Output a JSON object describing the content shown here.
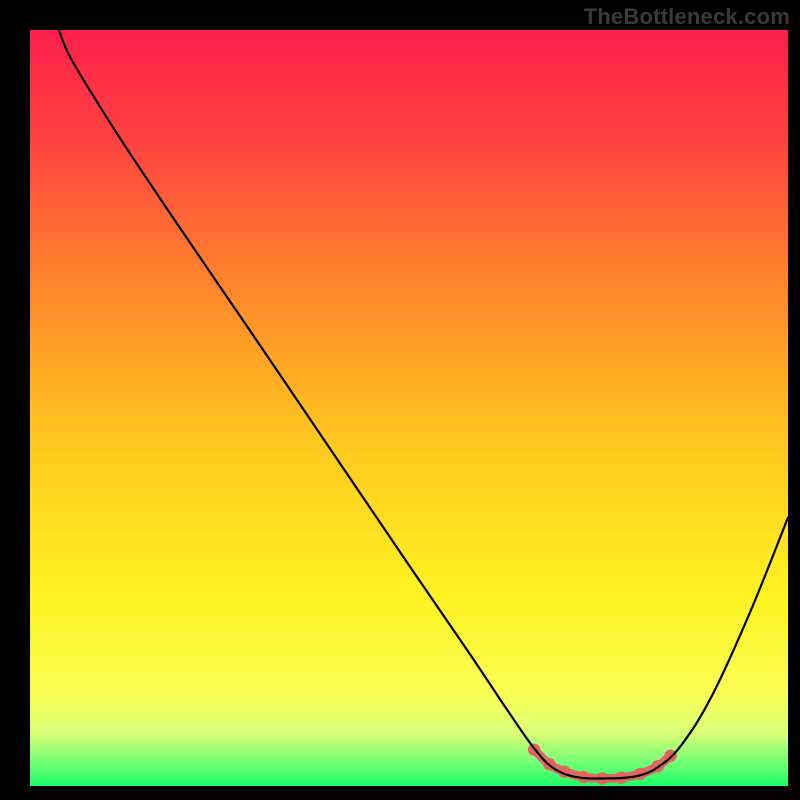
{
  "watermark": "TheBottleneck.com",
  "chart_data": {
    "type": "line",
    "title": "",
    "xlabel": "",
    "ylabel": "",
    "xlim": [
      0,
      100
    ],
    "ylim": [
      0,
      100
    ],
    "grid": false,
    "legend": false,
    "gradient_stops": [
      {
        "offset": 0.0,
        "color": "#ff1f4b"
      },
      {
        "offset": 0.15,
        "color": "#ff4440"
      },
      {
        "offset": 0.35,
        "color": "#ff8a2a"
      },
      {
        "offset": 0.55,
        "color": "#ffc91f"
      },
      {
        "offset": 0.75,
        "color": "#fff322"
      },
      {
        "offset": 0.88,
        "color": "#f9ff55"
      },
      {
        "offset": 0.93,
        "color": "#d8ff77"
      },
      {
        "offset": 0.965,
        "color": "#7dff77"
      },
      {
        "offset": 1.0,
        "color": "#1aff66"
      }
    ],
    "series": [
      {
        "name": "bottleneck-curve",
        "color": "#000000",
        "points": [
          {
            "x": 3.8,
            "y": 100.0
          },
          {
            "x": 5.0,
            "y": 97.0
          },
          {
            "x": 7.0,
            "y": 93.5
          },
          {
            "x": 12.0,
            "y": 85.5
          },
          {
            "x": 20.0,
            "y": 73.5
          },
          {
            "x": 30.0,
            "y": 58.8
          },
          {
            "x": 40.0,
            "y": 44.0
          },
          {
            "x": 50.0,
            "y": 29.2
          },
          {
            "x": 58.0,
            "y": 17.5
          },
          {
            "x": 63.0,
            "y": 10.0
          },
          {
            "x": 66.5,
            "y": 5.0
          },
          {
            "x": 69.0,
            "y": 2.4
          },
          {
            "x": 72.0,
            "y": 1.2
          },
          {
            "x": 76.0,
            "y": 1.0
          },
          {
            "x": 80.0,
            "y": 1.3
          },
          {
            "x": 83.0,
            "y": 2.6
          },
          {
            "x": 86.0,
            "y": 5.5
          },
          {
            "x": 90.0,
            "y": 12.0
          },
          {
            "x": 95.0,
            "y": 23.0
          },
          {
            "x": 100.0,
            "y": 35.5
          }
        ]
      }
    ],
    "highlight_band": {
      "name": "optimal-range",
      "color": "#e4635f",
      "points": [
        {
          "x": 66.5,
          "y": 4.8
        },
        {
          "x": 68.5,
          "y": 2.9
        },
        {
          "x": 70.5,
          "y": 1.9
        },
        {
          "x": 73.0,
          "y": 1.2
        },
        {
          "x": 75.5,
          "y": 1.0
        },
        {
          "x": 78.0,
          "y": 1.1
        },
        {
          "x": 80.5,
          "y": 1.6
        },
        {
          "x": 82.8,
          "y": 2.6
        },
        {
          "x": 84.5,
          "y": 4.0
        }
      ]
    }
  }
}
